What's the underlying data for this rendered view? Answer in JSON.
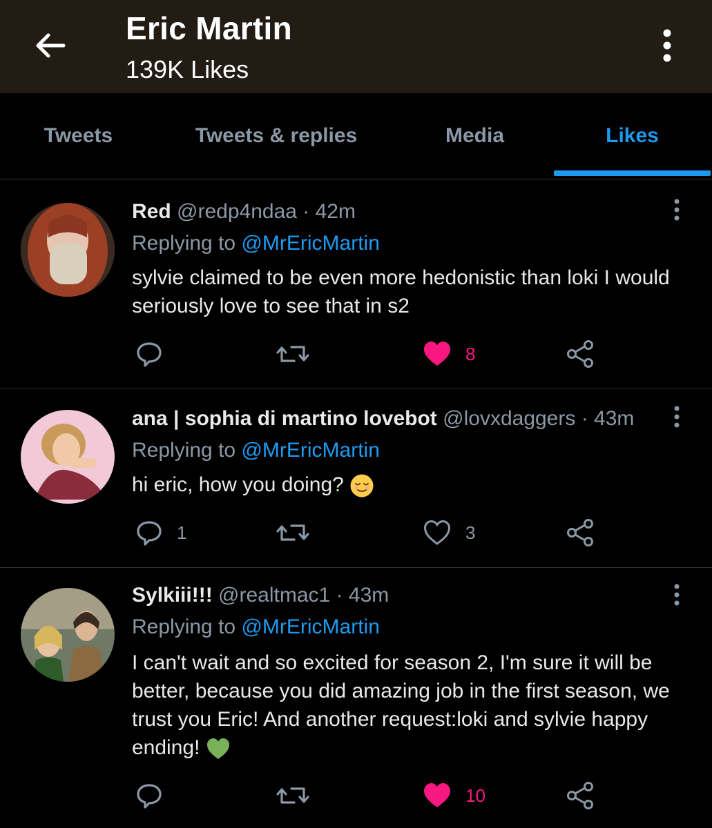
{
  "header": {
    "title": "Eric Martin",
    "subtitle": "139K Likes",
    "back_icon": "arrow-left-icon",
    "more_icon": "vertical-dots-icon"
  },
  "tabs": [
    {
      "label": "Tweets",
      "active": false
    },
    {
      "label": "Tweets & replies",
      "active": false
    },
    {
      "label": "Media",
      "active": false
    },
    {
      "label": "Likes",
      "active": true
    }
  ],
  "colors": {
    "accent": "#1d9bf0",
    "like": "#f91880",
    "muted": "#8b98a5",
    "header_bg": "#221c15"
  },
  "tweets": [
    {
      "name": "Red",
      "handle": "@redp4ndaa",
      "time": "· 42m",
      "replying_prefix": "Replying to",
      "replying_to": "@MrEricMartin",
      "text": "sylvie claimed to be even more hedonistic than loki I would seriously love to see that in s2",
      "replies": "",
      "retweets": "",
      "likes": "8",
      "liked": true
    },
    {
      "name": "ana | sophia di martino lovebot",
      "handle": "@lovxdaggers",
      "time": "· 43m",
      "replying_prefix": "Replying to",
      "replying_to": "@MrEricMartin",
      "text": "hi eric, how you doing?",
      "emoji": "relieved-face",
      "replies": "1",
      "retweets": "",
      "likes": "3",
      "liked": false
    },
    {
      "name": "Sylkiii!!!",
      "handle": "@realtmac1",
      "time": "· 43m",
      "replying_prefix": "Replying to",
      "replying_to": "@MrEricMartin",
      "text": "I can't wait and so excited for season 2, I'm sure it will be better, because you did amazing job in the first season, we trust you Eric! And another request:loki and sylvie happy ending!",
      "emoji": "green-heart",
      "replies": "",
      "retweets": "",
      "likes": "10",
      "liked": true
    }
  ]
}
